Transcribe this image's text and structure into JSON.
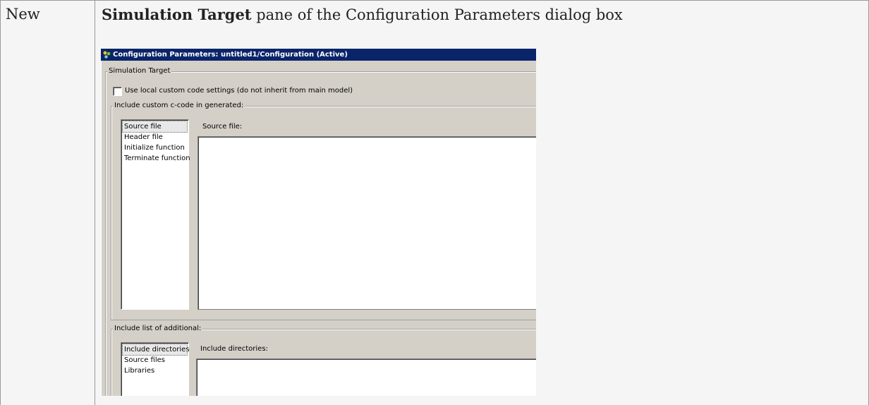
{
  "table": {
    "left_cell": "New",
    "caption_bold": "Simulation Target",
    "caption_rest": " pane of the Configuration Parameters dialog box"
  },
  "dialog": {
    "title": "Configuration Parameters: untitled1/Configuration (Active)",
    "title_icon": "gear-cluster-icon",
    "colors": {
      "titlebar": "#0a246a",
      "face": "#d4d0c8"
    },
    "group_title": "Simulation Target",
    "use_local_checkbox": {
      "label": "Use local custom code settings (do not inherit from main model)",
      "checked": false
    },
    "custom_code": {
      "title": "Include custom c-code in generated:",
      "items": [
        "Source file",
        "Header file",
        "Initialize function",
        "Terminate function"
      ],
      "selected_item": "Source file",
      "editor_label": "Source file:"
    },
    "additional": {
      "title": "Include list of additional:",
      "items": [
        "Include directories",
        "Source files",
        "Libraries"
      ],
      "selected_item": "Include directories",
      "editor_label": "Include directories:"
    }
  }
}
